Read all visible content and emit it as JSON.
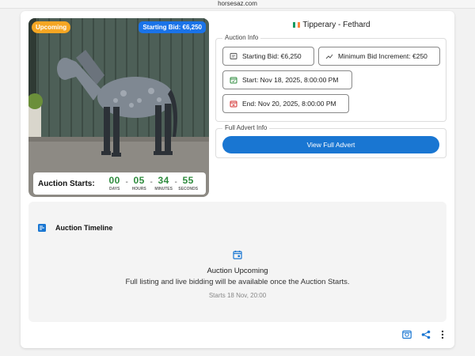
{
  "browser": {
    "url": "horsesaz.com"
  },
  "listing": {
    "status_badge": "Upcoming",
    "bid_badge": "Starting Bid: €6,250",
    "location": "Tipperary - Fethard"
  },
  "countdown": {
    "label": "Auction Starts:",
    "days": "00",
    "days_label": "DAYS",
    "hours": "05",
    "hours_label": "HOURS",
    "minutes": "34",
    "minutes_label": "MINUTES",
    "seconds": "55",
    "seconds_label": "SECONDS"
  },
  "auction_info": {
    "legend": "Auction Info",
    "starting_bid": "Starting Bid: €6,250",
    "min_increment": "Minimum Bid Increment: €250",
    "start": "Start: Nov 18, 2025, 8:00:00 PM",
    "end": "End: Nov 20, 2025, 8:00:00 PM"
  },
  "advert": {
    "legend": "Full Advert Info",
    "button": "View Full Advert"
  },
  "timeline": {
    "title": "Auction Timeline",
    "status": "Auction Upcoming",
    "description": "Full listing and live bidding will be available once the Auction Starts.",
    "starts": "Starts 18 Nov, 20:00"
  },
  "icons": {
    "bid": "gavel-icon",
    "increment": "trend-icon",
    "start": "calendar-start-icon",
    "end": "calendar-end-icon",
    "timeline": "timeline-icon",
    "event": "event-icon",
    "video": "video-icon",
    "share": "share-icon",
    "more": "more-vert-icon"
  },
  "colors": {
    "primary": "#1976d2",
    "upcoming": "#f5a623",
    "countdown": "#2e8b3d",
    "start_icon": "#2e8b3d",
    "end_icon": "#d32f2f"
  }
}
